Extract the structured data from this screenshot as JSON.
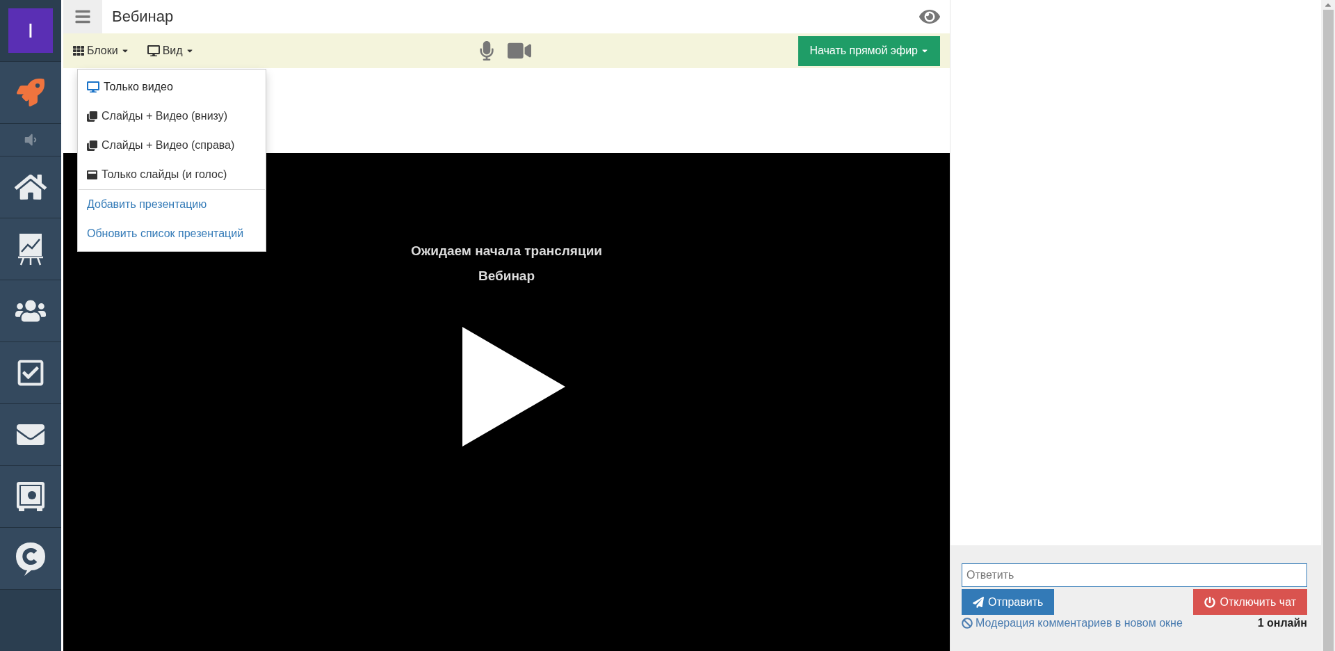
{
  "sidebar": {
    "logo": "I",
    "items": [
      {
        "kind": "rocket"
      },
      {
        "kind": "sound"
      },
      {
        "kind": "home"
      },
      {
        "kind": "chart"
      },
      {
        "kind": "people"
      },
      {
        "kind": "check"
      },
      {
        "kind": "mail"
      },
      {
        "kind": "safe"
      },
      {
        "kind": "chat"
      }
    ]
  },
  "header": {
    "title": "Вебинар"
  },
  "toolbar": {
    "blocks_label": "Блоки",
    "view_label": "Вид",
    "start_button": "Начать прямой эфир"
  },
  "view_menu": {
    "items": [
      {
        "kind": "video",
        "label": "Только видео",
        "selected": true
      },
      {
        "kind": "slides_video",
        "label": "Слайды + Видео (внизу)",
        "selected": false
      },
      {
        "kind": "slides_video",
        "label": "Слайды + Видео (справа)",
        "selected": false
      },
      {
        "kind": "slides",
        "label": "Только слайды (и голос)",
        "selected": false
      },
      {
        "kind": "link",
        "label": "Добавить презентацию"
      },
      {
        "kind": "link",
        "label": "Обновить список презентаций"
      }
    ]
  },
  "player": {
    "status": "Ожидаем начала трансляции",
    "title": "Вебинар"
  },
  "chat": {
    "placeholder": "Ответить",
    "send_button": "Отправить",
    "disable_button": "Отключить чат",
    "moderation_link": "Модерация комментариев в новом окне",
    "online": "1 онлайн"
  }
}
